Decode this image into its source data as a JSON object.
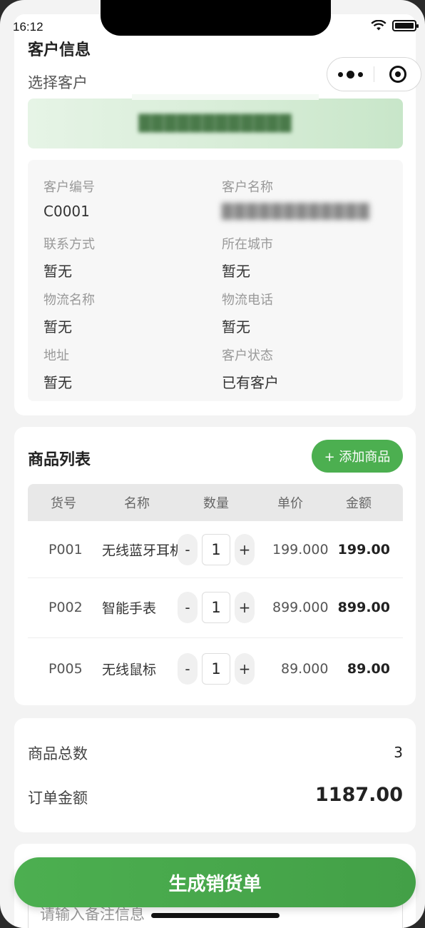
{
  "status_bar": {
    "time": "16:12"
  },
  "customer_section": {
    "title": "客户信息",
    "select_label": "选择客户",
    "selected_customer": "████████████",
    "fields": [
      {
        "label": "客户编号",
        "value": "C0001",
        "blurred": false
      },
      {
        "label": "客户名称",
        "value": "████████████",
        "blurred": true
      },
      {
        "label": "联系方式",
        "value": "暂无",
        "blurred": false
      },
      {
        "label": "所在城市",
        "value": "暂无",
        "blurred": false
      },
      {
        "label": "物流名称",
        "value": "暂无",
        "blurred": false
      },
      {
        "label": "物流电话",
        "value": "暂无",
        "blurred": false
      },
      {
        "label": "地址",
        "value": "暂无",
        "blurred": false
      },
      {
        "label": "客户状态",
        "value": "已有客户",
        "blurred": false
      }
    ]
  },
  "product_section": {
    "title": "商品列表",
    "add_button": "+ 添加商品",
    "columns": [
      "货号",
      "名称",
      "数量",
      "单价",
      "金额"
    ],
    "rows": [
      {
        "code": "P001",
        "name": "无线蓝牙耳机",
        "qty": "1",
        "price": "199.000",
        "amount": "199.00"
      },
      {
        "code": "P002",
        "name": "智能手表",
        "qty": "1",
        "price": "899.000",
        "amount": "899.00"
      },
      {
        "code": "P005",
        "name": "无线鼠标",
        "qty": "1",
        "price": "89.000",
        "amount": "89.00"
      }
    ],
    "minus": "-",
    "plus": "+"
  },
  "summary": {
    "total_count_label": "商品总数",
    "total_count": "3",
    "order_amount_label": "订单金额",
    "order_amount": "1187.00"
  },
  "remark": {
    "placeholder": "请输入备注信息"
  },
  "submit_button": "生成销货单",
  "colors": {
    "accent": "#4caf50",
    "select_bg": "#d6ecd6"
  },
  "icons": [
    "more-dots-icon",
    "target-icon",
    "wifi-icon",
    "battery-icon"
  ]
}
